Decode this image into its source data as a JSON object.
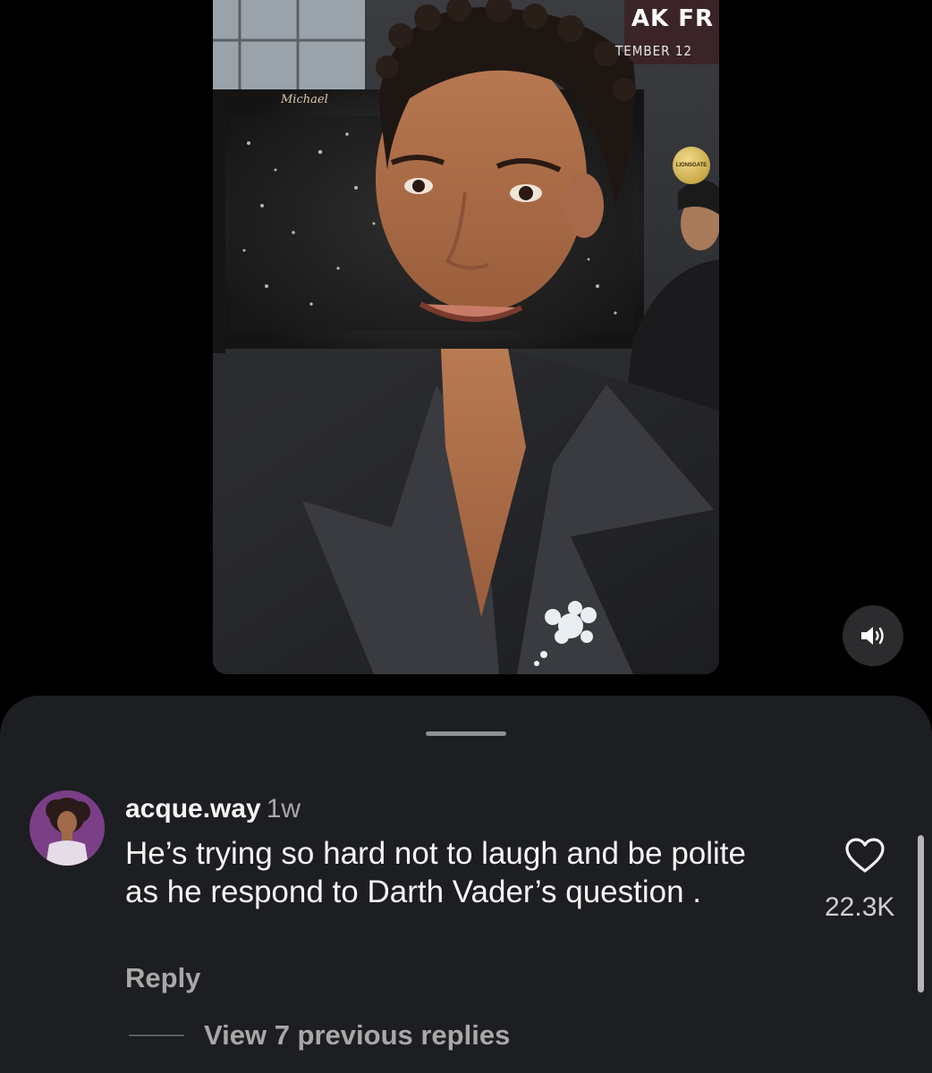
{
  "video": {
    "banner_text": "AK FR",
    "banner_subtext": "TEMBER 12",
    "sign_text": "Michael",
    "badge_text": "LIONSGATE",
    "mute_icon": "speaker-sound-icon"
  },
  "comment": {
    "username": "acque.way",
    "time_ago": "1w",
    "text": "He’s trying so hard not to laugh and be polite as he respond to Darth Vader’s question .",
    "reply_label": "Reply",
    "like_count": "22.3K",
    "like_icon": "heart-outline-icon",
    "view_replies_label": "View 7 previous replies"
  },
  "colors": {
    "background": "#000000",
    "sheet": "#1c1e21",
    "primary_text": "#f5f5f5",
    "secondary_text": "#a8a8a8"
  }
}
